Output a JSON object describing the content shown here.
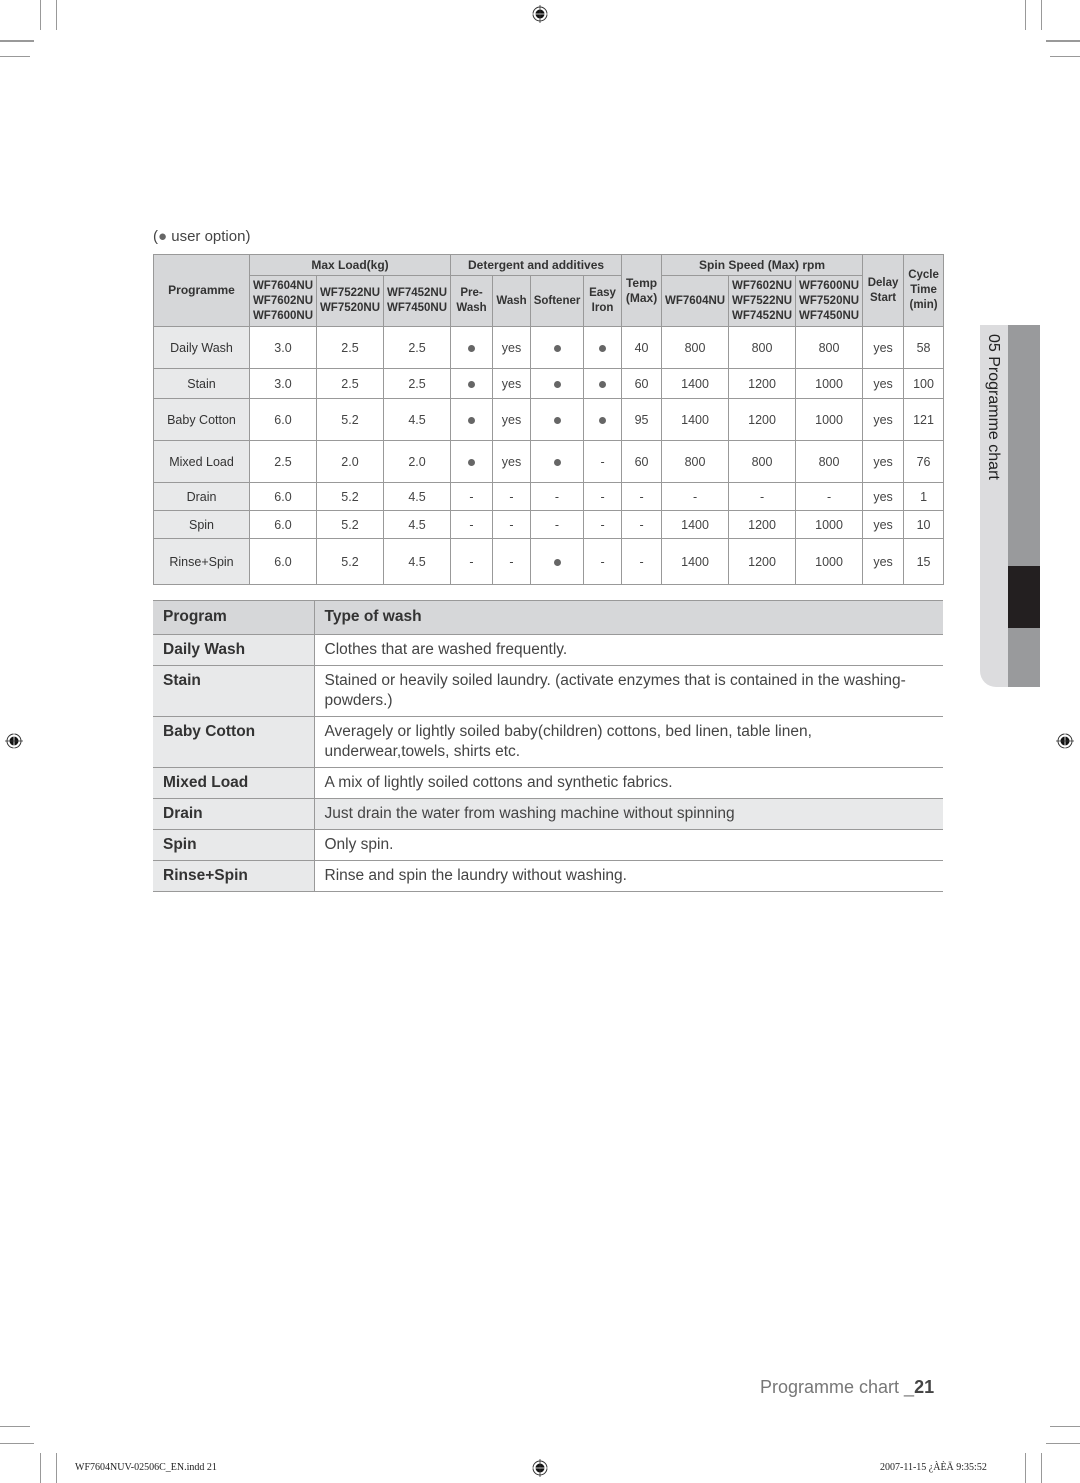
{
  "user_option_note": "user option",
  "chart": {
    "header": {
      "programme": "Programme",
      "max_load": "Max Load(kg)",
      "detergent": "Detergent and additives",
      "temp": "Temp (Max)",
      "spin_speed": "Spin Speed (Max) rpm",
      "delay_start": "Delay Start",
      "cycle_time": "Cycle Time (min)",
      "load_models": [
        "WF7604NU WF7602NU WF7600NU",
        "WF7522NU WF7520NU",
        "WF7452NU WF7450NU"
      ],
      "detergent_cols": [
        "Pre- Wash",
        "Wash",
        "Softener",
        "Easy Iron"
      ],
      "spin_models": [
        "WF7604NU",
        "WF7602NU WF7522NU WF7452NU",
        "WF7600NU WF7520NU WF7450NU"
      ]
    },
    "rows": [
      {
        "name": "Daily Wash",
        "icon": "(daily-wash-icon)",
        "loads": [
          "3.0",
          "2.5",
          "2.5"
        ],
        "prewash": "bullet",
        "wash": "yes",
        "softener": "bullet",
        "easy_iron": "bullet",
        "temp": "40",
        "spin": [
          "800",
          "800",
          "800"
        ],
        "delay": "yes",
        "cycle": "58"
      },
      {
        "name": "Stain",
        "icon": "",
        "loads": [
          "3.0",
          "2.5",
          "2.5"
        ],
        "prewash": "bullet",
        "wash": "yes",
        "softener": "bullet",
        "easy_iron": "bullet",
        "temp": "60",
        "spin": [
          "1400",
          "1200",
          "1000"
        ],
        "delay": "yes",
        "cycle": "100"
      },
      {
        "name": "Baby Cotton",
        "icon": "(baby-icon)",
        "loads": [
          "6.0",
          "5.2",
          "4.5"
        ],
        "prewash": "bullet",
        "wash": "yes",
        "softener": "bullet",
        "easy_iron": "bullet",
        "temp": "95",
        "spin": [
          "1400",
          "1200",
          "1000"
        ],
        "delay": "yes",
        "cycle": "121"
      },
      {
        "name": "Mixed Load",
        "icon": "(mix-icon)",
        "loads": [
          "2.5",
          "2.0",
          "2.0"
        ],
        "prewash": "bullet",
        "wash": "yes",
        "softener": "bullet",
        "easy_iron": "-",
        "temp": "60",
        "spin": [
          "800",
          "800",
          "800"
        ],
        "delay": "yes",
        "cycle": "76"
      },
      {
        "name": "Drain",
        "icon": "",
        "loads": [
          "6.0",
          "5.2",
          "4.5"
        ],
        "prewash": "-",
        "wash": "-",
        "softener": "-",
        "easy_iron": "-",
        "temp": "-",
        "spin": [
          "-",
          "-",
          "-"
        ],
        "delay": "yes",
        "cycle": "1"
      },
      {
        "name": "Spin",
        "icon": "",
        "loads": [
          "6.0",
          "5.2",
          "4.5"
        ],
        "prewash": "-",
        "wash": "-",
        "softener": "-",
        "easy_iron": "-",
        "temp": "-",
        "spin": [
          "1400",
          "1200",
          "1000"
        ],
        "delay": "yes",
        "cycle": "10"
      },
      {
        "name": "Rinse+Spin",
        "icon": "(rinse-spin-icon)",
        "loads": [
          "6.0",
          "5.2",
          "4.5"
        ],
        "prewash": "-",
        "wash": "-",
        "softener": "bullet",
        "easy_iron": "-",
        "temp": "-",
        "spin": [
          "1400",
          "1200",
          "1000"
        ],
        "delay": "yes",
        "cycle": "15"
      }
    ]
  },
  "descriptions": {
    "header": {
      "program": "Program",
      "type": "Type of wash"
    },
    "rows": [
      {
        "program": "Daily Wash",
        "text": "Clothes that are washed frequently."
      },
      {
        "program": "Stain",
        "text": "Stained or heavily soiled laundry. (activate enzymes that is contained in the washing-powders.)"
      },
      {
        "program": "Baby Cotton",
        "text": "Averagely or lightly soiled baby(children) cottons, bed linen, table linen, underwear,towels, shirts etc."
      },
      {
        "program": "Mixed Load",
        "text": "A mix of lightly soiled cottons and synthetic fabrics."
      },
      {
        "program": "Drain",
        "text": "Just drain the water from washing machine without spinning"
      },
      {
        "program": "Spin",
        "text": "Only spin."
      },
      {
        "program": "Rinse+Spin",
        "text": "Rinse and spin the laundry without washing."
      }
    ]
  },
  "side_tab": "05 Programme chart",
  "footer": {
    "title": "Programme chart _",
    "page": "21"
  },
  "print_info": {
    "file": "WF7604NUV-02506C_EN.indd   21",
    "date": "2007-11-15   ¿ÀÈÄ 9:35:52"
  }
}
